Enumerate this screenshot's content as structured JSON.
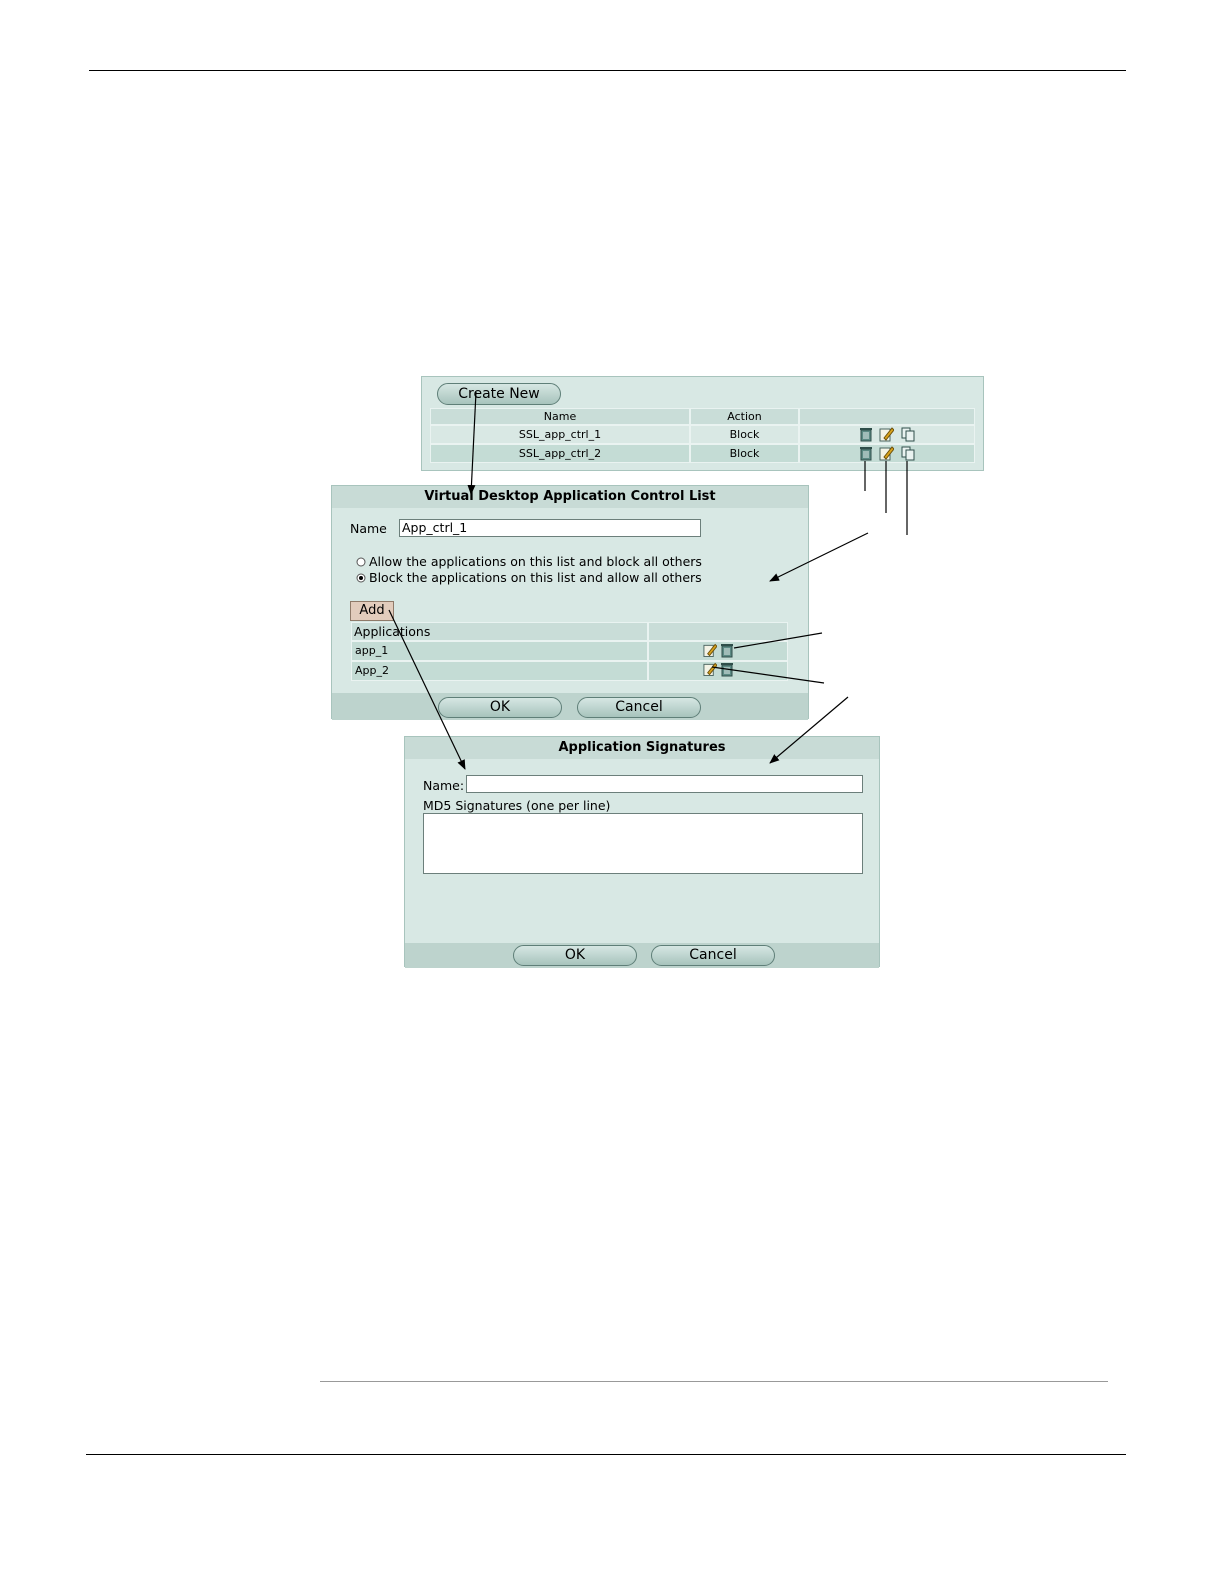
{
  "list_panel": {
    "create_new": "Create New",
    "columns": [
      "Name",
      "Action"
    ],
    "rows": [
      {
        "name": "SSL_app_ctrl_1",
        "action": "Block"
      },
      {
        "name": "SSL_app_ctrl_2",
        "action": "Block"
      }
    ]
  },
  "control_dialog": {
    "title": "Virtual Desktop Application Control List",
    "name_label": "Name",
    "name_value": "App_ctrl_1",
    "radio_allow": "Allow the applications on this list and block all others",
    "radio_block": "Block the applications on this list and allow all others",
    "add_button": "Add",
    "apps_header": "Applications",
    "apps": [
      "app_1",
      "App_2"
    ],
    "ok": "OK",
    "cancel": "Cancel"
  },
  "signatures_dialog": {
    "title": "Application Signatures",
    "name_label": "Name:",
    "name_value": "",
    "md5_label": "MD5 Signatures (one per line)",
    "md5_value": "",
    "ok": "OK",
    "cancel": "Cancel"
  }
}
